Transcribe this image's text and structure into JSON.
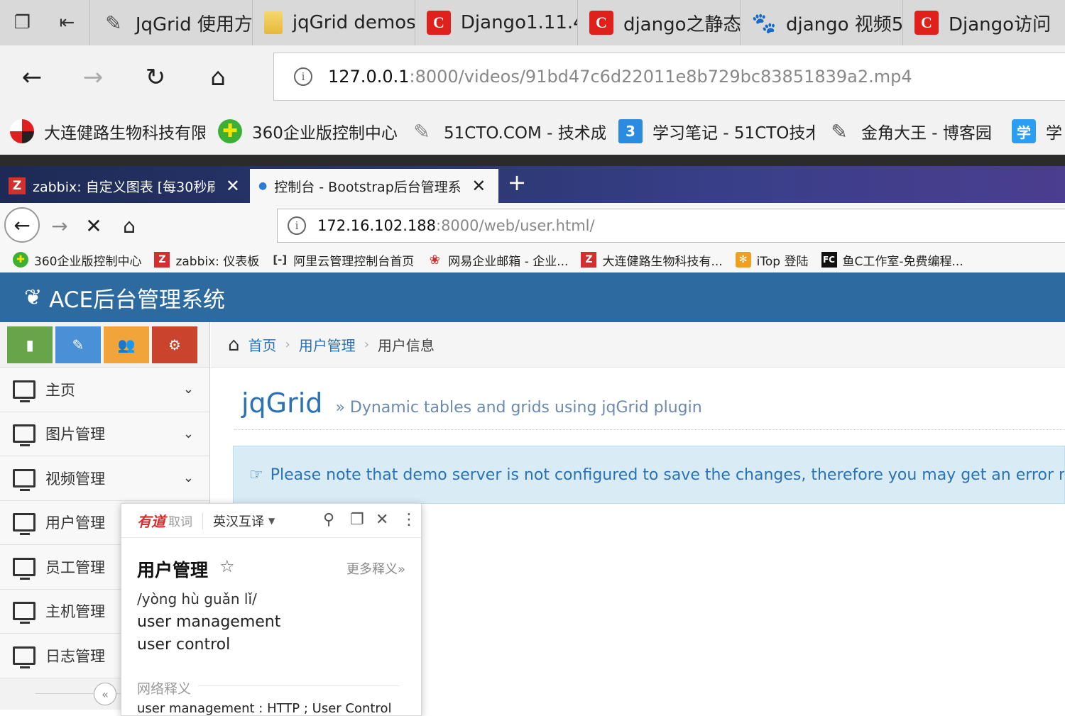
{
  "outer_browser": {
    "tabs": [
      {
        "label": "JqGrid 使用方",
        "icon": "feather-icon"
      },
      {
        "label": "jqGrid demos",
        "icon": "folder-icon"
      },
      {
        "label": "Django1.11.4",
        "icon": "c-logo-icon"
      },
      {
        "label": "django之静态",
        "icon": "c-logo-icon"
      },
      {
        "label": "django 视频5",
        "icon": "baidu-paw-icon"
      },
      {
        "label": "Django访问",
        "icon": "c-logo-icon"
      }
    ],
    "address": {
      "host": "127.0.0.1",
      "path": ":8000/videos/91bd47c6d22011e8b729bc83851839a2.mp4"
    },
    "bookmarks": [
      {
        "label": "大连健路生物科技有限",
        "icon": "dalian-logo-icon"
      },
      {
        "label": "360企业版控制中心",
        "icon": "360-logo-icon"
      },
      {
        "label": "51CTO.COM - 技术成",
        "icon": "51cto-logo-icon"
      },
      {
        "label": "学习笔记 - 51CTO技术",
        "icon": "51cto-3-icon"
      },
      {
        "label": "金角大王 - 博客园",
        "icon": "feather-icon"
      },
      {
        "label": "学",
        "icon": "xue-icon"
      }
    ]
  },
  "inner_browser": {
    "tabs": [
      {
        "label": "zabbix: 自定义图表 [每30秒刷",
        "icon": "zabbix-icon",
        "active": false
      },
      {
        "label": "控制台 - Bootstrap后台管理系",
        "icon": "loading-icon",
        "active": true
      }
    ],
    "address": {
      "host": "172.16.102.188",
      "path": ":8000/web/user.html/"
    },
    "bookmarks": [
      {
        "label": "360企业版控制中心",
        "icon": "360"
      },
      {
        "label": "zabbix: 仪表板",
        "icon": "Z"
      },
      {
        "label": "阿里云管理控制台首页",
        "icon": "ali"
      },
      {
        "label": "网易企业邮箱 - 企业...",
        "icon": "163"
      },
      {
        "label": "大连健路生物科技有...",
        "icon": "Z"
      },
      {
        "label": "iTop 登陆",
        "icon": "itop"
      },
      {
        "label": "鱼C工作室-免费编程...",
        "icon": "FC"
      }
    ]
  },
  "app": {
    "brand": "ACE后台管理系统",
    "sidebar": {
      "shortcuts": [
        {
          "name": "signal",
          "color": "#68a44a"
        },
        {
          "name": "pencil",
          "color": "#4a90d6"
        },
        {
          "name": "users",
          "color": "#f0a43a"
        },
        {
          "name": "cogs",
          "color": "#c9432d"
        }
      ],
      "menu": [
        {
          "label": "主页",
          "has_chevron": true
        },
        {
          "label": "图片管理",
          "has_chevron": true
        },
        {
          "label": "视频管理",
          "has_chevron": true
        },
        {
          "label": "用户管理",
          "has_chevron": false
        },
        {
          "label": "员工管理",
          "has_chevron": false
        },
        {
          "label": "主机管理",
          "has_chevron": false
        },
        {
          "label": "日志管理",
          "has_chevron": false
        }
      ]
    },
    "breadcrumbs": [
      {
        "label": "首页",
        "link": true
      },
      {
        "label": "用户管理",
        "link": true
      },
      {
        "label": "用户信息",
        "link": false
      }
    ],
    "page_title": "jqGrid",
    "page_subtitle": "» Dynamic tables and grids using jqGrid plugin",
    "alert_text": "Please note that demo server is not configured to save the changes, therefore you may get an error message."
  },
  "youdao_popup": {
    "logo": "有道",
    "logo_sub": "取词",
    "mode": "英汉互译",
    "word": "用户管理",
    "more": "更多释义»",
    "pinyin": "/yòng hù guǎn lǐ/",
    "meanings": [
      "user management",
      "user control"
    ],
    "web_section": "网络释义",
    "web_entry": "user management : HTTP ; User Control"
  }
}
